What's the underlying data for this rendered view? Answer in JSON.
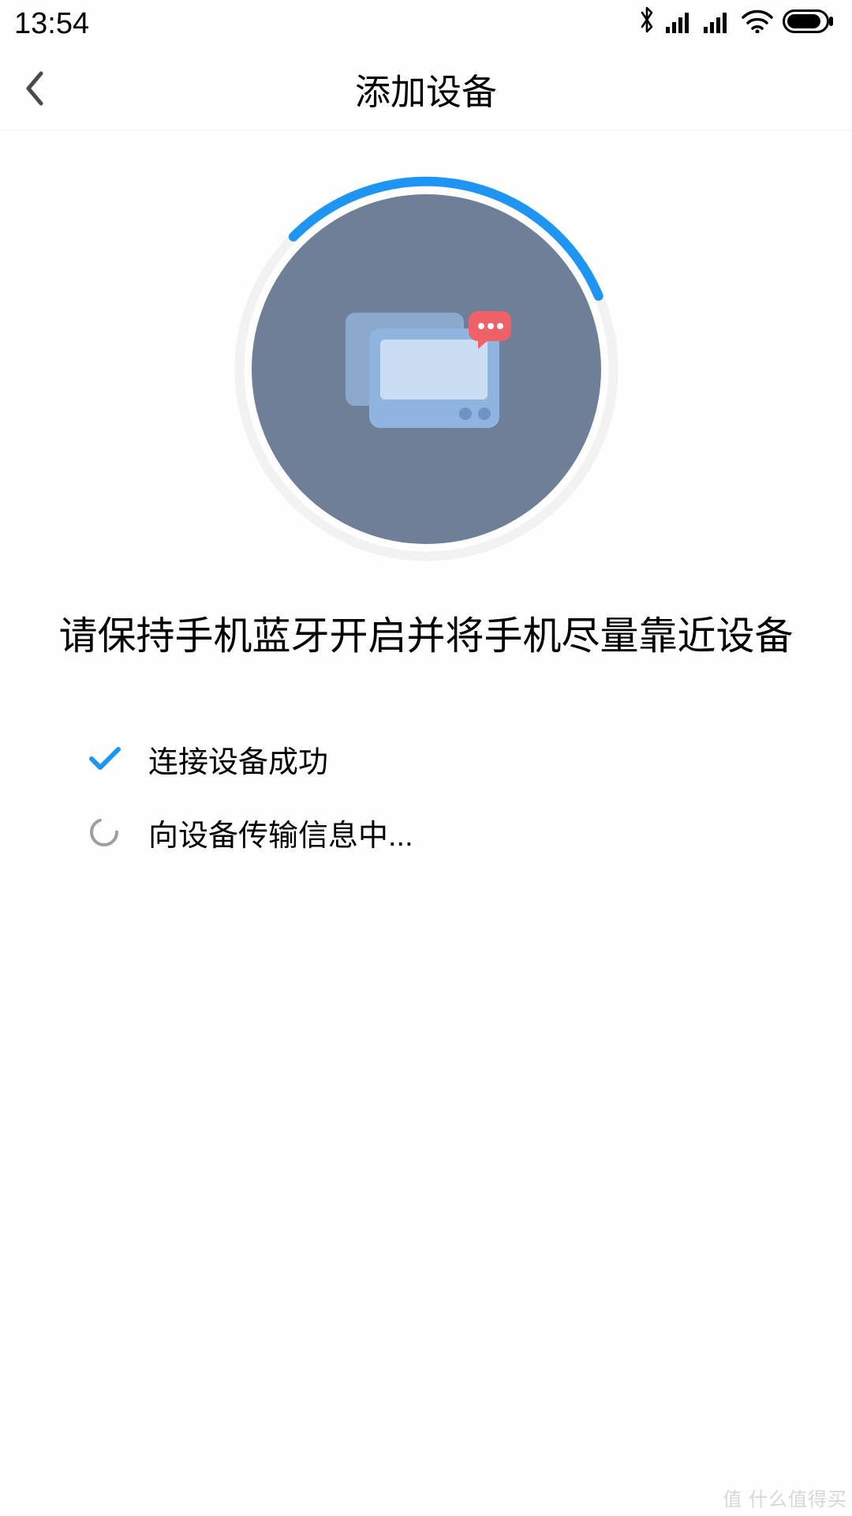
{
  "statusbar": {
    "time": "13:54"
  },
  "header": {
    "title": "添加设备"
  },
  "instruction": "请保持手机蓝牙开启并将手机尽量靠近设备",
  "steps": [
    {
      "label": "连接设备成功",
      "state": "done"
    },
    {
      "label": "向设备传输信息中...",
      "state": "loading"
    }
  ],
  "watermark": "值 什么值得买"
}
